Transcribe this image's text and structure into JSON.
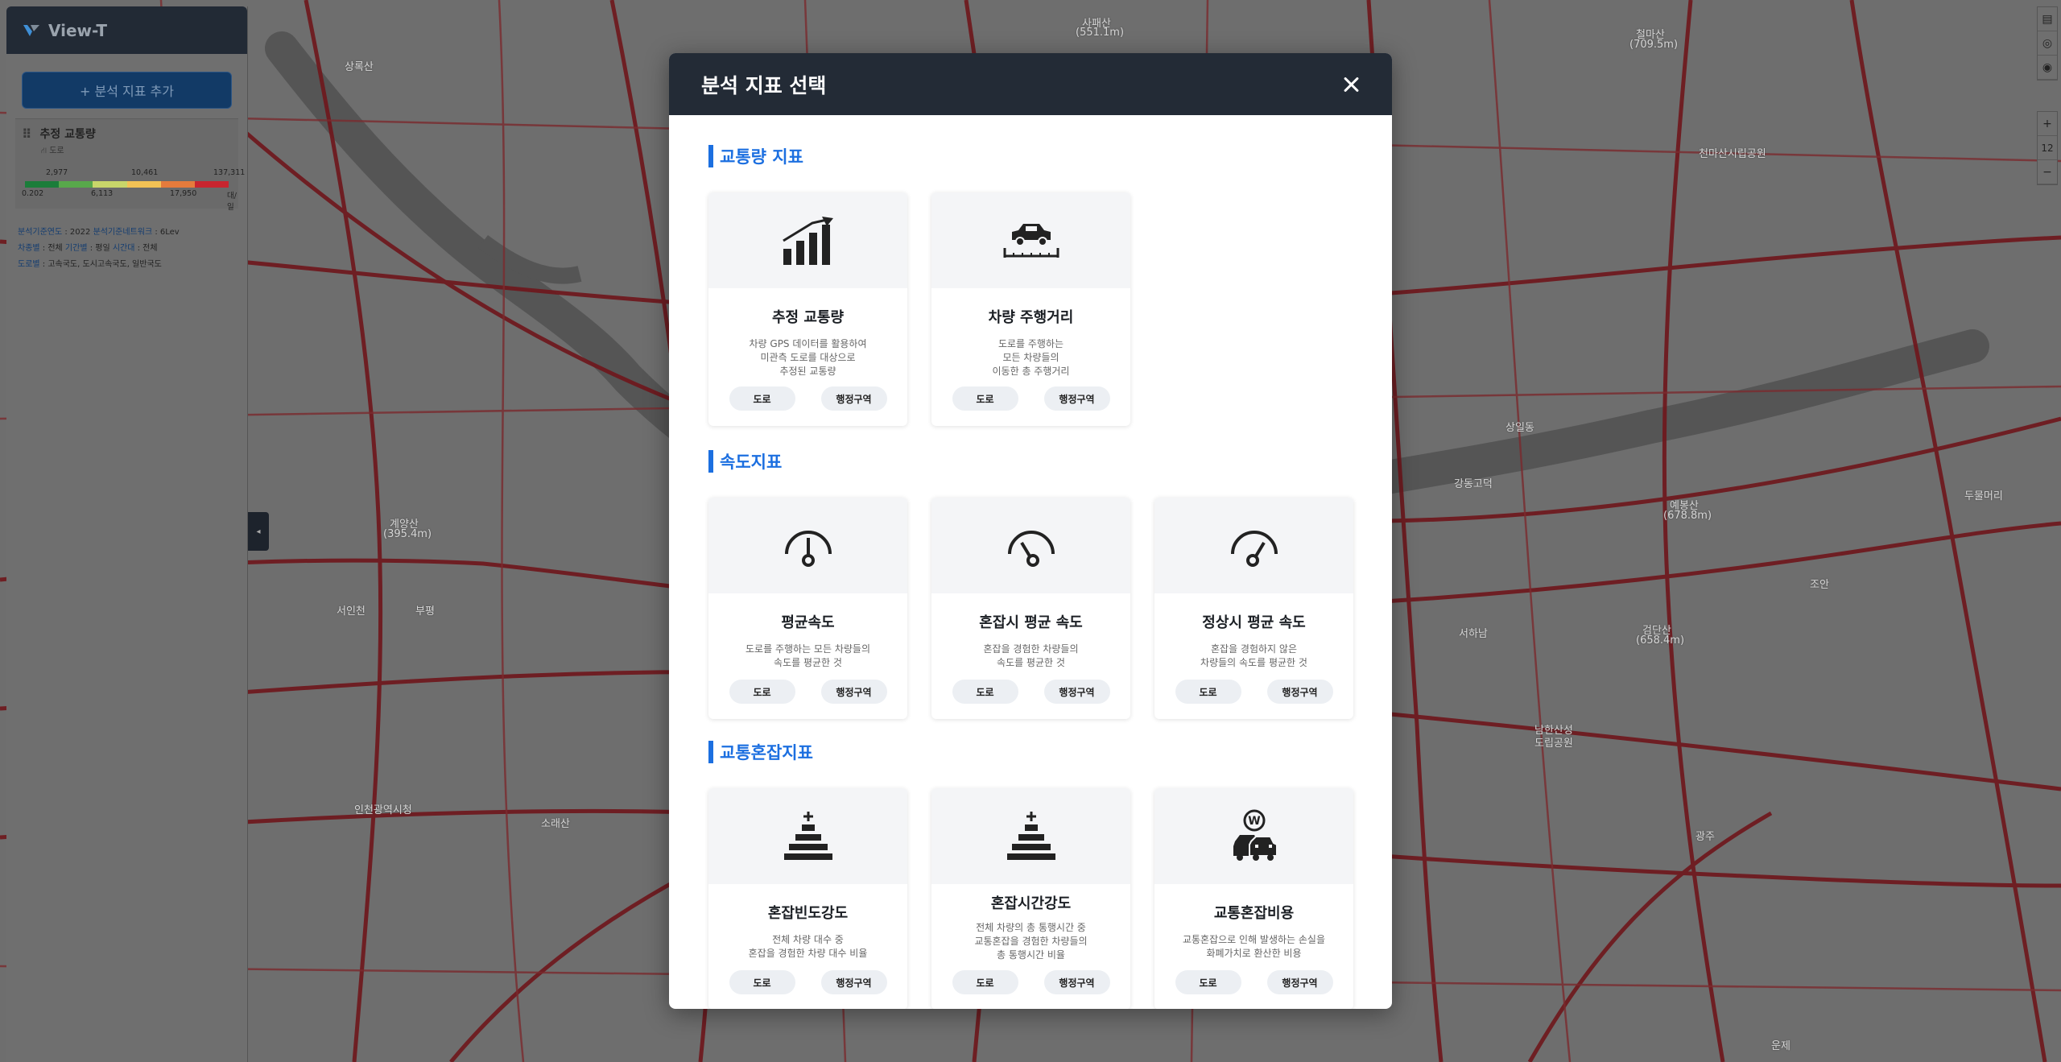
{
  "app": {
    "title": "View-T",
    "add_button": "+ 분석 지표 추가"
  },
  "layer": {
    "title": "추정 교통량",
    "subtitle": "도로",
    "legend_top": [
      "2,977",
      "10,461",
      "137,311"
    ],
    "legend_bottom": [
      "0.202",
      "6,113",
      "17,950",
      "대/일"
    ],
    "legend_colors": [
      "#1b7d3a",
      "#58a84b",
      "#c8d66a",
      "#f2c255",
      "#e57b3c",
      "#c7252f"
    ]
  },
  "filters": [
    {
      "label": "분석기준연도",
      "text": " : 2022 ",
      "label2": "분석기준네트워크",
      "text2": " : 6Lev"
    },
    {
      "label": "차종별",
      "text": " : 전체  ",
      "label2": "기간별",
      "text2": " : 평일  ",
      "label3": "시간대",
      "text3": " : 전체"
    },
    {
      "label": "도로별",
      "text": " : 고속국도, 도시고속국도, 일반국도"
    }
  ],
  "map_labels": [
    {
      "text": "사패산"
    },
    {
      "text": "(551.1m)"
    },
    {
      "text": "철마산"
    },
    {
      "text": "(709.5m)"
    },
    {
      "text": "상록산"
    },
    {
      "text": "천마산시립공원"
    },
    {
      "text": "예봉산"
    },
    {
      "text": "(678.8m)"
    },
    {
      "text": "검단산"
    },
    {
      "text": "(658.4m)"
    },
    {
      "text": "계양산"
    },
    {
      "text": "(395.4m)"
    },
    {
      "text": "강동고덕"
    },
    {
      "text": "서하남"
    },
    {
      "text": "남한산성"
    },
    {
      "text": "도립공원"
    },
    {
      "text": "인천광역시청"
    },
    {
      "text": "소래산"
    },
    {
      "text": "두물머리"
    },
    {
      "text": "조안"
    },
    {
      "text": "상일동"
    },
    {
      "text": "서인천"
    },
    {
      "text": "부평"
    },
    {
      "text": "광주"
    },
    {
      "text": "운제"
    }
  ],
  "map_controls": {
    "zoom_in": "+",
    "zoom_level": "12",
    "zoom_out": "−"
  },
  "modal": {
    "title": "분석 지표 선택",
    "sections": [
      {
        "title": "교통량 지표",
        "cards": [
          {
            "icon": "chart-growth-icon",
            "title": "추정 교통량",
            "desc": [
              "차량 GPS 데이터를 활용하여",
              "미관측 도로를 대상으로",
              "추정된 교통량"
            ],
            "btn1": "도로",
            "btn2": "행정구역"
          },
          {
            "icon": "car-distance-icon",
            "title": "차량 주행거리",
            "desc": [
              "도로를 주행하는",
              "모든 차량들의",
              "이동한 총 주행거리"
            ],
            "btn1": "도로",
            "btn2": "행정구역"
          }
        ]
      },
      {
        "title": "속도지표",
        "cards": [
          {
            "icon": "gauge-mid-icon",
            "title": "평균속도",
            "desc": [
              "도로를 주행하는 모든 차량들의",
              "속도를 평균한 것"
            ],
            "btn1": "도로",
            "btn2": "행정구역"
          },
          {
            "icon": "gauge-low-icon",
            "title": "혼잡시 평균 속도",
            "desc": [
              "혼잡을 경험한 차량들의",
              "속도를 평균한 것"
            ],
            "btn1": "도로",
            "btn2": "행정구역"
          },
          {
            "icon": "gauge-high-icon",
            "title": "정상시 평균 속도",
            "desc": [
              "혼잡을 경험하지 않은",
              "차량들의 속도를 평균한 것"
            ],
            "btn1": "도로",
            "btn2": "행정구역"
          }
        ]
      },
      {
        "title": "교통혼잡지표",
        "cards": [
          {
            "icon": "pyramid-icon",
            "title": "혼잡빈도강도",
            "desc": [
              "전체 차량 대수 중",
              "혼잡을 경험한 차량 대수 비율"
            ],
            "btn1": "도로",
            "btn2": "행정구역"
          },
          {
            "icon": "pyramid-icon",
            "title": "혼잡시간강도",
            "desc": [
              "전체 차량의 총 통행시간 중",
              "교통혼잡을 경험한 차량들의",
              "총 통행시간 비율"
            ],
            "btn1": "도로",
            "btn2": "행정구역"
          },
          {
            "icon": "cost-car-icon",
            "title": "교통혼잡비용",
            "desc": [
              "교통혼잡으로 인해 발생하는 손실을",
              "화폐가치로 환산한 비용"
            ],
            "btn1": "도로",
            "btn2": "행정구역"
          }
        ]
      }
    ]
  }
}
